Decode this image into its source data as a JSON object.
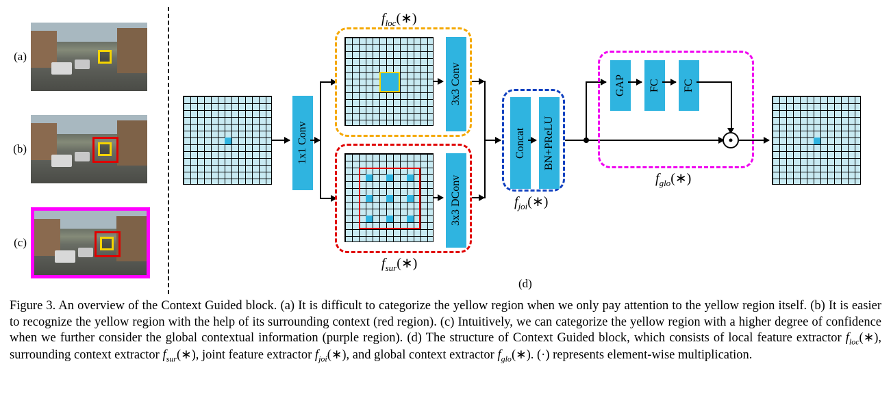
{
  "thumbs": {
    "a_label": "(a)",
    "b_label": "(b)",
    "c_label": "(c)"
  },
  "blocks": {
    "conv1x1": "1x1 Conv",
    "conv3x3": "3x3 Conv",
    "dconv3x3": "3x3 DConv",
    "concat": "Concat",
    "bnprelu": "BN+PReLU",
    "gap": "GAP",
    "fc1": "FC",
    "fc2": "FC"
  },
  "funcs": {
    "floc": "f",
    "floc_sub": "loc",
    "fsur": "f",
    "fsur_sub": "sur",
    "fjoi": "f",
    "fjoi_sub": "joi",
    "fglo": "f",
    "fglo_sub": "glo",
    "arg": "(∗)"
  },
  "sub_d": "(d)",
  "caption": {
    "lead": "Figure 3. An overview of the Context Guided block. (a) It is difficult to categorize the yellow region when we only pay attention to the yellow region itself. (b) It is easier to recognize the yellow region with the help of its surrounding context (red region). (c) Intuitively, we can categorize the yellow region with a higher degree of confidence when we further consider the global contextual information (purple region). (d) The structure of Context Guided block, which consists of local feature extractor ",
    "p1": "(∗), surrounding context extractor ",
    "p2": "(∗), joint feature extractor ",
    "p3": "(∗), and global context extractor ",
    "p4": "(∗). (·) represents element-wise multiplication."
  }
}
